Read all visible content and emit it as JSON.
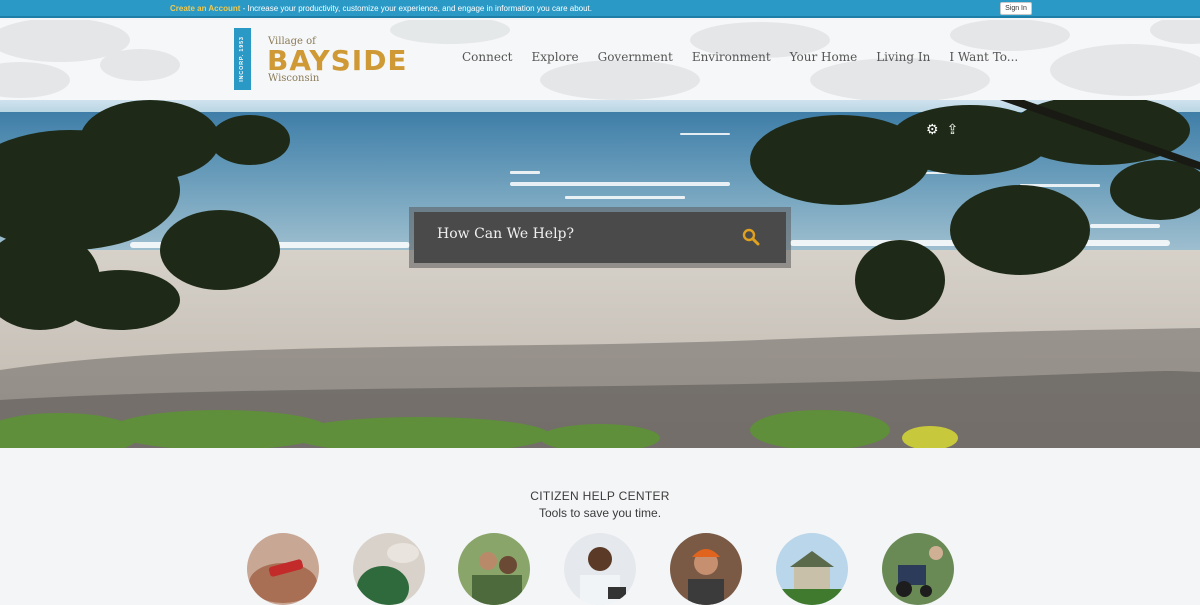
{
  "topbar": {
    "create_account": "Create an Account",
    "message": " - Increase your productivity, customize your experience, and engage in information you care about.",
    "sign_in": "Sign In"
  },
  "logo": {
    "incorp": "INCORP. 1953",
    "village_of": "Village of",
    "name": "BAYSIDE",
    "state": "Wisconsin"
  },
  "nav": {
    "items": [
      {
        "label": "Connect"
      },
      {
        "label": "Explore"
      },
      {
        "label": "Government"
      },
      {
        "label": "Environment"
      },
      {
        "label": "Your Home"
      },
      {
        "label": "Living In"
      },
      {
        "label": "I Want To..."
      }
    ]
  },
  "hero": {
    "gear_icon": "gear-icon",
    "share_icon": "share-icon"
  },
  "search": {
    "placeholder": "How Can We Help?",
    "icon": "search-icon"
  },
  "help_center": {
    "title": "CITIZEN HELP CENTER",
    "subtitle": "Tools to save you time."
  },
  "colors": {
    "topbar": "#2a99c6",
    "accent_gold": "#cf9a35",
    "search_icon": "#e0a020"
  }
}
